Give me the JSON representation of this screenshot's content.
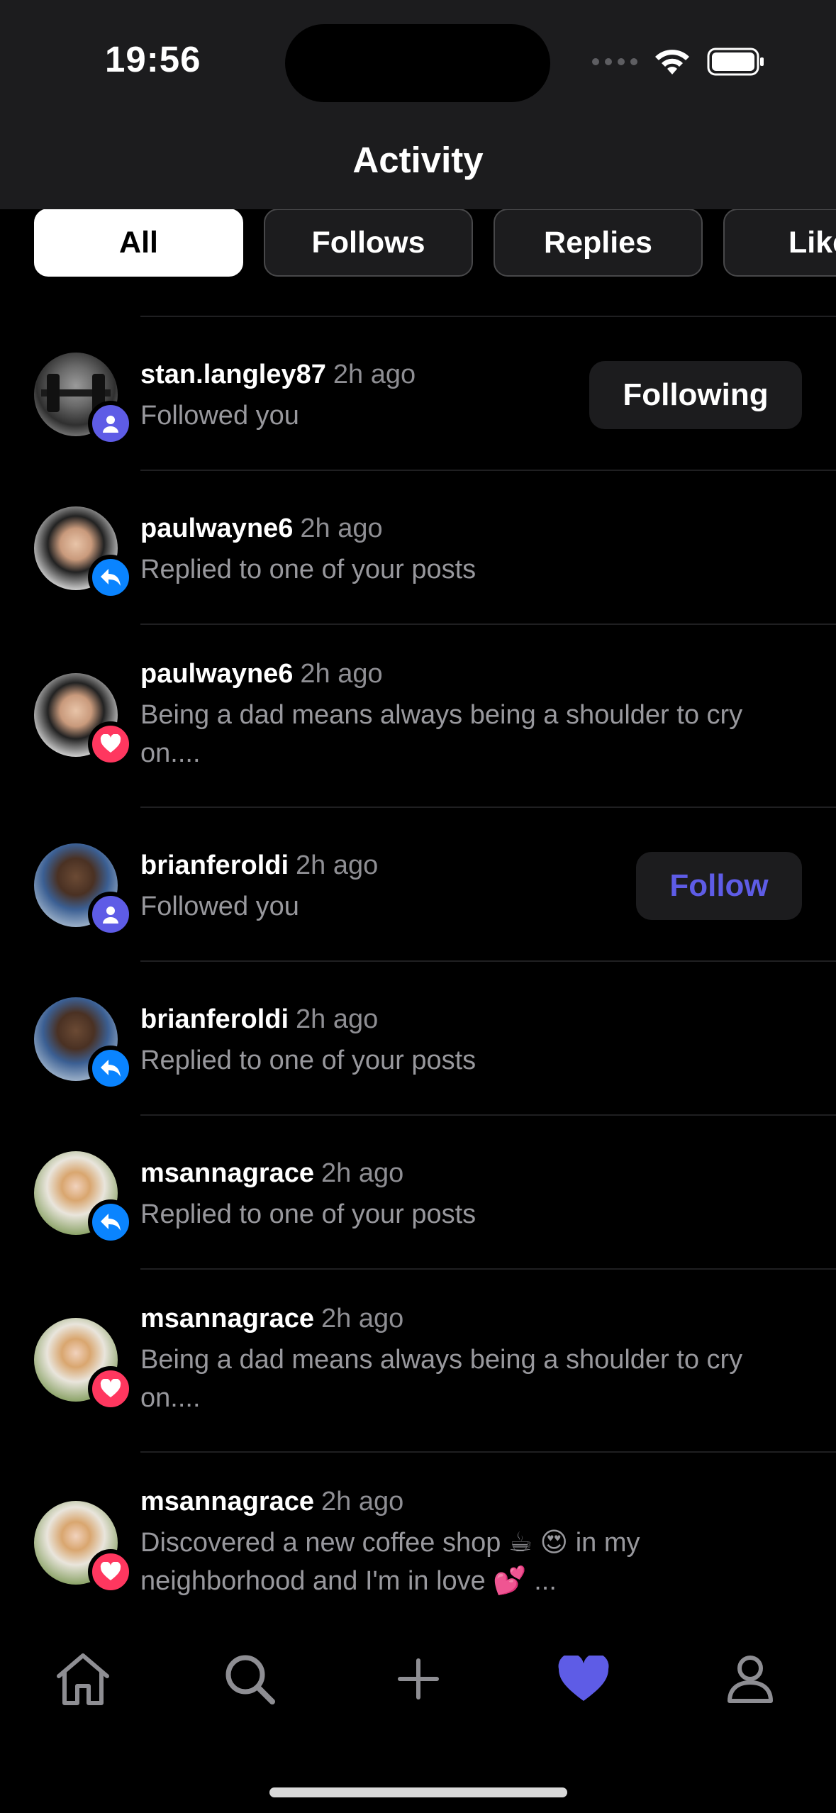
{
  "status_bar": {
    "time": "19:56"
  },
  "header": {
    "title": "Activity"
  },
  "filters": [
    {
      "label": "All",
      "active": true
    },
    {
      "label": "Follows",
      "active": false
    },
    {
      "label": "Replies",
      "active": false
    },
    {
      "label": "Likes",
      "active": false
    }
  ],
  "activities": [
    {
      "username": "stan.langley87",
      "time": "2h ago",
      "text": "Followed you",
      "type": "follow",
      "button": "Following"
    },
    {
      "username": "paulwayne6",
      "time": "2h ago",
      "text": "Replied to one of your posts",
      "type": "reply"
    },
    {
      "username": "paulwayne6",
      "time": "2h ago",
      "text": "Being a dad means always being a shoulder to cry on....",
      "type": "like"
    },
    {
      "username": "brianferoldi",
      "time": "2h ago",
      "text": "Followed you",
      "type": "follow",
      "button": "Follow"
    },
    {
      "username": "brianferoldi",
      "time": "2h ago",
      "text": "Replied to one of your posts",
      "type": "reply"
    },
    {
      "username": "msannagrace",
      "time": "2h ago",
      "text": "Replied to one of your posts",
      "type": "reply"
    },
    {
      "username": "msannagrace",
      "time": "2h ago",
      "text": "Being a dad means always being a shoulder to cry on....",
      "type": "like"
    },
    {
      "username": "msannagrace",
      "time": "2h ago",
      "text": "Discovered a new coffee shop ☕ 😍 in my neighborhood and I'm in love 💕 ...",
      "type": "like"
    }
  ],
  "tab_bar": [
    {
      "icon": "home-icon"
    },
    {
      "icon": "search-icon"
    },
    {
      "icon": "plus-icon"
    },
    {
      "icon": "heart-icon",
      "active": true
    },
    {
      "icon": "profile-icon"
    }
  ],
  "colors": {
    "accent": "#5e5ce6",
    "follow_badge": "#5e5ce6",
    "reply_badge": "#0a84ff",
    "like_badge": "#ff375f",
    "header_bg": "#1c1c1e"
  }
}
